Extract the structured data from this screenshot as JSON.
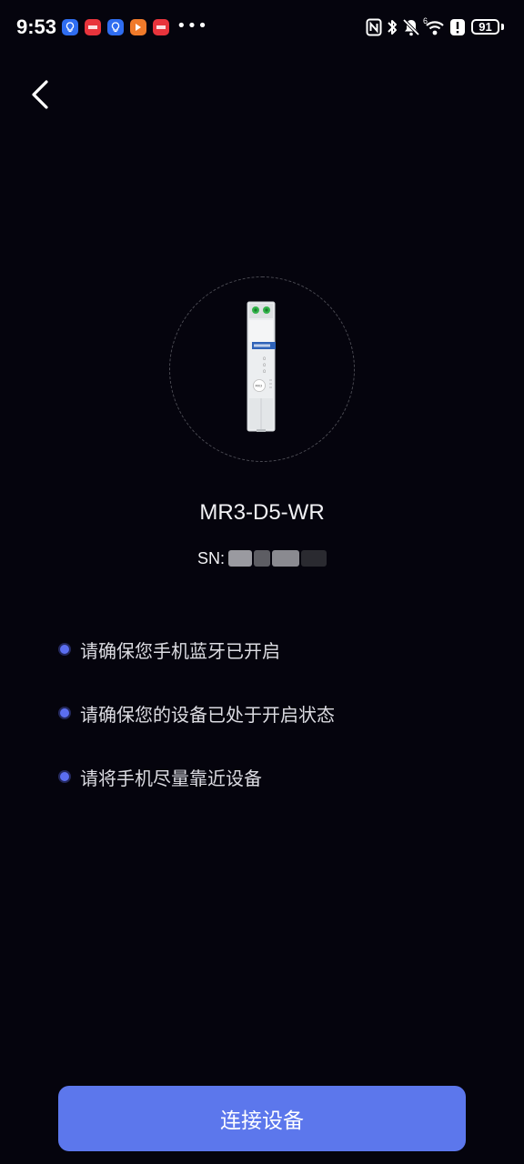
{
  "status_bar": {
    "time": "9:53",
    "battery": "91",
    "notification_icons": [
      {
        "name": "bulb-app-icon",
        "color": "#2f6df0",
        "glyph": "●"
      },
      {
        "name": "sale-app-icon",
        "color": "#e8343c",
        "glyph": "■"
      },
      {
        "name": "bulb-app-icon-2",
        "color": "#2f6df0",
        "glyph": "●"
      },
      {
        "name": "play-app-icon",
        "color": "#f07a2a",
        "glyph": "▶"
      },
      {
        "name": "sale-app-icon-2",
        "color": "#e8343c",
        "glyph": "■"
      }
    ],
    "more_indicator": "•••"
  },
  "header": {
    "back_icon": "chevron-left-icon"
  },
  "device": {
    "model": "MR3-D5-WR",
    "sn_label": "SN:"
  },
  "tips": [
    {
      "text": "请确保您手机蓝牙已开启"
    },
    {
      "text": "请确保您的设备已处于开启状态"
    },
    {
      "text": "请将手机尽量靠近设备"
    }
  ],
  "actions": {
    "connect_label": "连接设备"
  },
  "colors": {
    "background": "#05040d",
    "accent": "#5c77ec",
    "tip_dot": "#5b6ef0"
  }
}
